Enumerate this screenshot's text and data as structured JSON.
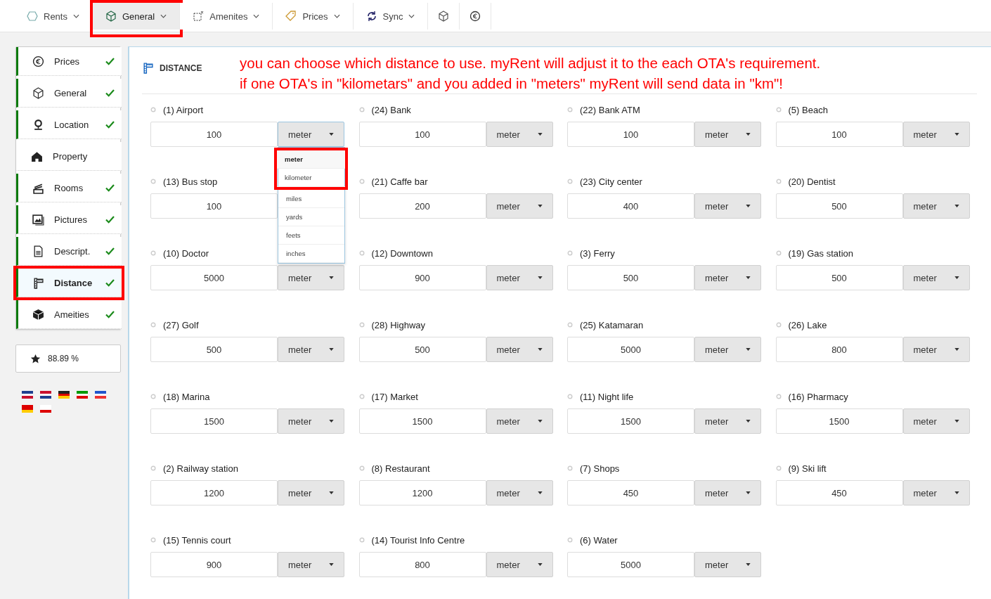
{
  "nav_tabs": [
    {
      "kind": "menu",
      "label": "Rents",
      "selected": false,
      "highlighted": false
    },
    {
      "kind": "menu",
      "label": "General",
      "selected": true,
      "highlighted": true
    },
    {
      "kind": "menu",
      "label": "Amenites",
      "selected": false,
      "highlighted": false
    },
    {
      "kind": "menu",
      "label": "Prices",
      "selected": false,
      "highlighted": false
    },
    {
      "kind": "menu",
      "label": "Sync",
      "selected": false,
      "highlighted": false
    },
    {
      "kind": "icon",
      "selected": false,
      "highlighted": false
    },
    {
      "kind": "icon",
      "selected": false,
      "highlighted": false
    }
  ],
  "sidebar": {
    "items": [
      {
        "label": "Prices",
        "complete": true,
        "selected": false,
        "highlighted": false
      },
      {
        "label": "General",
        "complete": true,
        "selected": false,
        "highlighted": false
      },
      {
        "label": "Location",
        "complete": true,
        "selected": false,
        "highlighted": false
      },
      {
        "label": "Property",
        "complete": false,
        "selected": false,
        "highlighted": false
      },
      {
        "label": "Rooms",
        "complete": true,
        "selected": false,
        "highlighted": false
      },
      {
        "label": "Pictures",
        "complete": true,
        "selected": false,
        "highlighted": false
      },
      {
        "label": "Descript.",
        "complete": true,
        "selected": false,
        "highlighted": false
      },
      {
        "label": "Distance",
        "complete": true,
        "selected": true,
        "highlighted": true
      },
      {
        "label": "Ameities",
        "complete": true,
        "selected": false,
        "highlighted": false
      }
    ],
    "score": "88.89 %"
  },
  "panel": {
    "title": "DISTANCE",
    "note": [
      "you can choose which distance to use. myRent will adjust it to the each OTA's requirement.",
      "if one OTA's in \"kilometars\" and you added in \"meters\" myRent will send data in \"km\"!"
    ],
    "fields": [
      {
        "label": "(1) Airport",
        "value": "100",
        "unit": "meter",
        "expanded": true
      },
      {
        "label": "(24) Bank",
        "value": "100",
        "unit": "meter",
        "expanded": false
      },
      {
        "label": "(22) Bank ATM",
        "value": "100",
        "unit": "meter",
        "expanded": false
      },
      {
        "label": "(5) Beach",
        "value": "100",
        "unit": "meter",
        "expanded": false
      },
      {
        "label": "(13) Bus stop",
        "value": "100"
      },
      {
        "label": "(21) Caffe bar",
        "value": "200",
        "unit": "meter",
        "expanded": false
      },
      {
        "label": "(23) City center",
        "value": "400",
        "unit": "meter",
        "expanded": false
      },
      {
        "label": "(20) Dentist",
        "value": "500",
        "unit": "meter",
        "expanded": false
      },
      {
        "label": "(10) Doctor",
        "value": "5000",
        "unit": "meter",
        "expanded": false
      },
      {
        "label": "(12) Downtown",
        "value": "900",
        "unit": "meter",
        "expanded": false
      },
      {
        "label": "(3) Ferry",
        "value": "500",
        "unit": "meter",
        "expanded": false
      },
      {
        "label": "(19) Gas station",
        "value": "500",
        "unit": "meter",
        "expanded": false
      },
      {
        "label": "(27) Golf",
        "value": "500",
        "unit": "meter",
        "expanded": false
      },
      {
        "label": "(28) Highway",
        "value": "500",
        "unit": "meter",
        "expanded": false
      },
      {
        "label": "(25) Katamaran",
        "value": "5000",
        "unit": "meter",
        "expanded": false
      },
      {
        "label": "(26) Lake",
        "value": "800",
        "unit": "meter",
        "expanded": false
      },
      {
        "label": "(18) Marina",
        "value": "1500",
        "unit": "meter",
        "expanded": false
      },
      {
        "label": "(17) Market",
        "value": "1500",
        "unit": "meter",
        "expanded": false
      },
      {
        "label": "(11) Night life",
        "value": "1500",
        "unit": "meter",
        "expanded": false
      },
      {
        "label": "(16) Pharmacy",
        "value": "1500",
        "unit": "meter",
        "expanded": false
      },
      {
        "label": "(2) Railway station",
        "value": "1200",
        "unit": "meter",
        "expanded": false
      },
      {
        "label": "(8) Restaurant",
        "value": "1200",
        "unit": "meter",
        "expanded": false
      },
      {
        "label": "(7) Shops",
        "value": "450",
        "unit": "meter",
        "expanded": false
      },
      {
        "label": "(9) Ski lift",
        "value": "450",
        "unit": "meter",
        "expanded": false
      },
      {
        "label": "(15) Tennis court",
        "value": "900",
        "unit": "meter",
        "expanded": false
      },
      {
        "label": "(14) Tourist Info Centre",
        "value": "800",
        "unit": "meter",
        "expanded": false
      },
      {
        "label": "(6) Water",
        "value": "5000",
        "unit": "meter",
        "expanded": false
      }
    ],
    "unit_options": [
      {
        "label": "meter",
        "selected": true,
        "highlighted": true
      },
      {
        "label": "kilometer",
        "selected": false,
        "highlighted": true
      },
      {
        "label": "miles",
        "selected": false,
        "highlighted": false
      },
      {
        "label": "yards",
        "selected": false,
        "highlighted": false
      },
      {
        "label": "feets",
        "selected": false,
        "highlighted": false
      },
      {
        "label": "inches",
        "selected": false,
        "highlighted": false
      }
    ]
  }
}
